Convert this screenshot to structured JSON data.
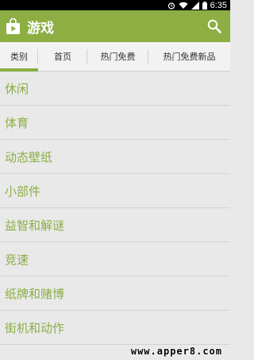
{
  "status_bar": {
    "time": "6:35",
    "icons": [
      "alarm-icon",
      "wifi-icon",
      "signal-icon",
      "battery-icon"
    ]
  },
  "action_bar": {
    "title": "游戏",
    "logo_icon": "shopping-bag-icon",
    "search_icon": "search-icon",
    "accent_color": "#8cae43"
  },
  "tabs": [
    {
      "label": "类别",
      "active": true
    },
    {
      "label": "首页",
      "active": false
    },
    {
      "label": "热门免费",
      "active": false
    },
    {
      "label": "热门免费新品",
      "active": false
    }
  ],
  "categories": [
    "休闲",
    "体育",
    "动态壁纸",
    "小部件",
    "益智和解谜",
    "竞速",
    "纸牌和赌博",
    "街机和动作"
  ],
  "watermark": "www.apper8.com"
}
